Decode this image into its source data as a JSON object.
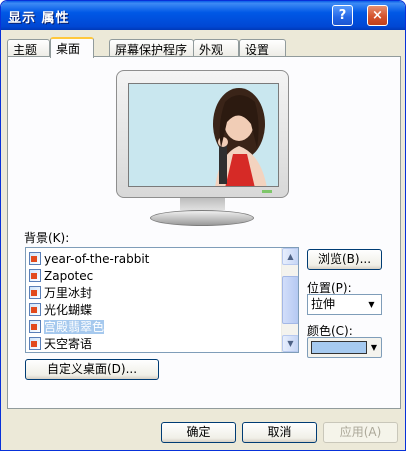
{
  "window": {
    "title": "显示 属性",
    "help_label": "?",
    "close_label": "×"
  },
  "tabs": [
    {
      "label": "主题"
    },
    {
      "label": "桌面"
    },
    {
      "label": "屏幕保护程序"
    },
    {
      "label": "外观"
    },
    {
      "label": "设置"
    }
  ],
  "background": {
    "label": "背景(K):",
    "items": [
      {
        "label": "year-of-the-rabbit",
        "selected": false
      },
      {
        "label": "Zapotec",
        "selected": false
      },
      {
        "label": "万里冰封",
        "selected": false
      },
      {
        "label": "光化蝴蝶",
        "selected": false
      },
      {
        "label": "宫殿翡翠色",
        "selected": true
      },
      {
        "label": "天空寄语",
        "selected": false
      }
    ]
  },
  "buttons": {
    "browse": "浏览(B)...",
    "customize": "自定义桌面(D)...",
    "ok": "确定",
    "cancel": "取消",
    "apply": "应用(A)"
  },
  "position": {
    "label": "位置(P):",
    "value": "拉伸"
  },
  "color": {
    "label": "颜色(C):",
    "value": "#a6caf0"
  }
}
